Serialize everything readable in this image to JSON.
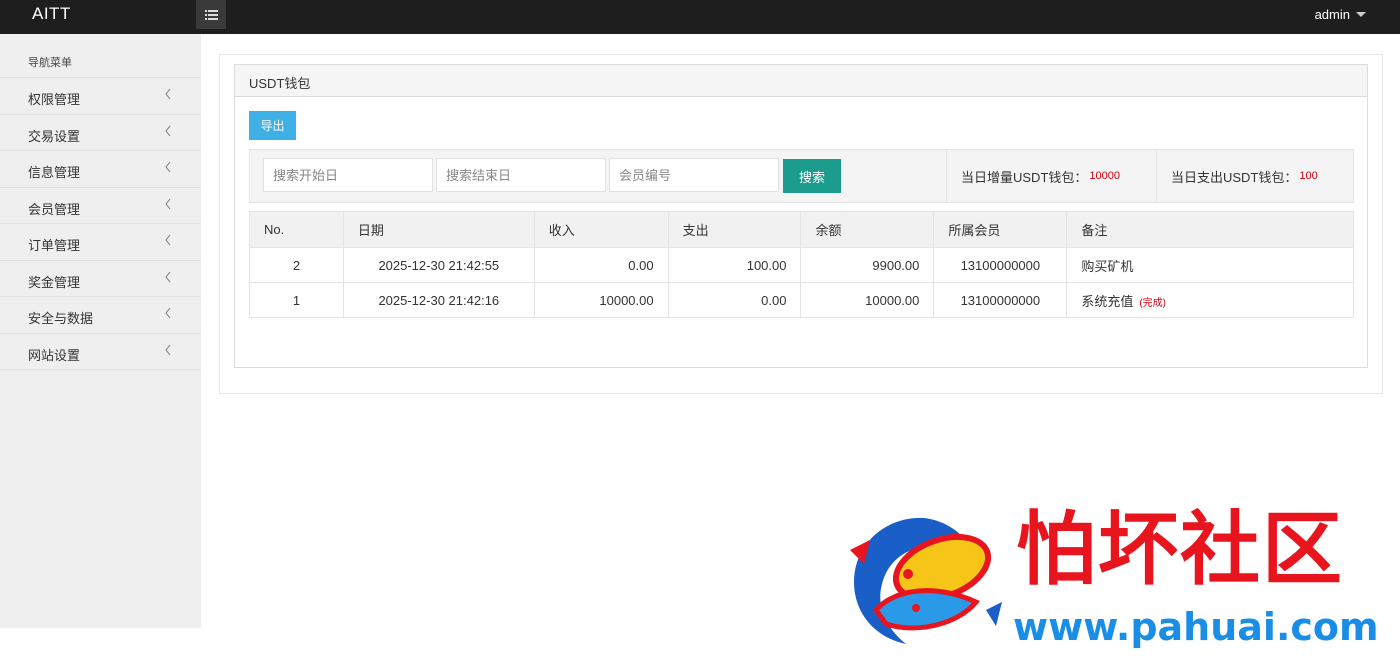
{
  "header": {
    "brand": "AITT",
    "user": "admin"
  },
  "sidebar": {
    "title": "导航菜单",
    "items": [
      {
        "label": "权限管理"
      },
      {
        "label": "交易设置"
      },
      {
        "label": "信息管理"
      },
      {
        "label": "会员管理"
      },
      {
        "label": "订单管理"
      },
      {
        "label": "奖金管理"
      },
      {
        "label": "安全与数据"
      },
      {
        "label": "网站设置"
      }
    ]
  },
  "panel": {
    "title": "USDT钱包",
    "export_label": "导出",
    "search": {
      "start_placeholder": "搜索开始日",
      "end_placeholder": "搜索结束日",
      "member_placeholder": "会员编号",
      "button_label": "搜索"
    },
    "stats": {
      "increase_label": "当日增量USDT钱包：",
      "increase_value": "10000",
      "expense_label": "当日支出USDT钱包：",
      "expense_value": "100"
    },
    "table": {
      "headers": [
        "No.",
        "日期",
        "收入",
        "支出",
        "余额",
        "所属会员",
        "备注"
      ],
      "rows": [
        {
          "no": "2",
          "date": "2025-12-30 21:42:55",
          "income": "0.00",
          "expense": "100.00",
          "balance": "9900.00",
          "member": "13100000000",
          "note": "购买矿机",
          "tag": ""
        },
        {
          "no": "1",
          "date": "2025-12-30 21:42:16",
          "income": "10000.00",
          "expense": "0.00",
          "balance": "10000.00",
          "member": "13100000000",
          "note": "系统充值",
          "tag": "(完成)"
        }
      ]
    }
  },
  "watermark": {
    "name": "怕坏社区",
    "url": "www.pahuai.com"
  },
  "colors": {
    "topbar": "#1e1e1e",
    "accent_blue": "#3eb0e6",
    "accent_teal": "#1b9c8c",
    "value_red": "#d6000f"
  }
}
